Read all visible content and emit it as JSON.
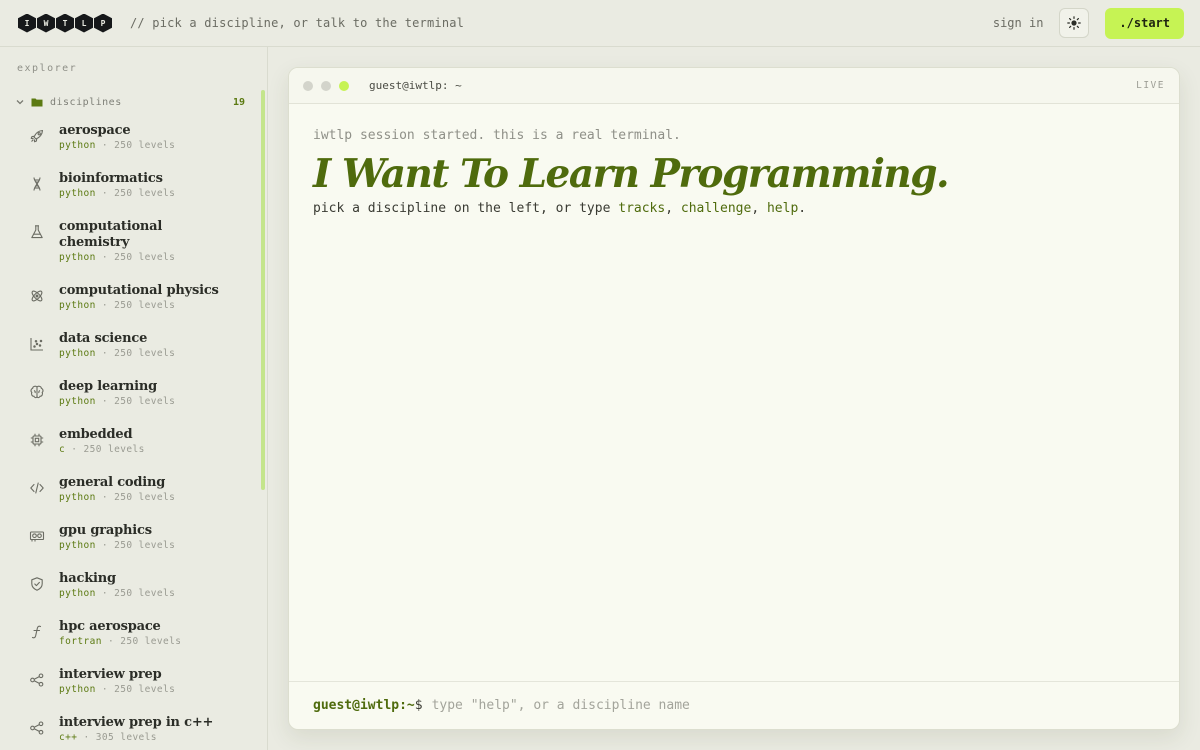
{
  "header": {
    "logo_letters": [
      "I",
      "W",
      "T",
      "L",
      "P"
    ],
    "tagline": "// pick a discipline, or talk to the terminal",
    "signin_label": "sign in",
    "theme_icon": "sun-icon",
    "start_label": "./start"
  },
  "sidebar": {
    "explorer_label": "explorer",
    "folder": {
      "name": "disciplines",
      "count": "19"
    },
    "items": [
      {
        "name": "aerospace",
        "lang": "python",
        "levels": "· 250 levels",
        "icon": "rocket-icon"
      },
      {
        "name": "bioinformatics",
        "lang": "python",
        "levels": "· 250 levels",
        "icon": "dna-icon"
      },
      {
        "name": "computational chemistry",
        "lang": "python",
        "levels": "· 250 levels",
        "icon": "flask-icon"
      },
      {
        "name": "computational physics",
        "lang": "python",
        "levels": "· 250 levels",
        "icon": "atom-icon"
      },
      {
        "name": "data science",
        "lang": "python",
        "levels": "· 250 levels",
        "icon": "scatter-chart-icon"
      },
      {
        "name": "deep learning",
        "lang": "python",
        "levels": "· 250 levels",
        "icon": "brain-icon"
      },
      {
        "name": "embedded",
        "lang": "c",
        "levels": "· 250 levels",
        "icon": "chip-icon"
      },
      {
        "name": "general coding",
        "lang": "python",
        "levels": "· 250 levels",
        "icon": "code-icon"
      },
      {
        "name": "gpu graphics",
        "lang": "python",
        "levels": "· 250 levels",
        "icon": "gpu-card-icon"
      },
      {
        "name": "hacking",
        "lang": "python",
        "levels": "· 250 levels",
        "icon": "shield-icon"
      },
      {
        "name": "hpc aerospace",
        "lang": "fortran",
        "levels": "· 250 levels",
        "icon": "function-icon"
      },
      {
        "name": "interview prep",
        "lang": "python",
        "levels": "· 250 levels",
        "icon": "graph-nodes-icon"
      },
      {
        "name": "interview prep in c++",
        "lang": "c++",
        "levels": "· 305 levels",
        "icon": "graph-nodes-icon"
      }
    ]
  },
  "terminal": {
    "title": "guest@iwtlp: ~",
    "status": "LIVE",
    "session_line": "iwtlp session started. this is a real terminal.",
    "headline": "I Want To Learn Programming.",
    "hint_prefix": "pick a discipline on the left, or type",
    "hint_kw1": "tracks",
    "hint_kw2": "challenge",
    "hint_kw3": "help",
    "prompt": "guest@iwtlp:~",
    "prompt_symbol": "$",
    "input_placeholder": "type \"help\", or a discipline name",
    "input_value": ""
  },
  "colors": {
    "accent": "#c6f354",
    "brand_green": "#4f6b0d",
    "background": "#eaebe2",
    "terminal_bg": "#f9faf1"
  }
}
